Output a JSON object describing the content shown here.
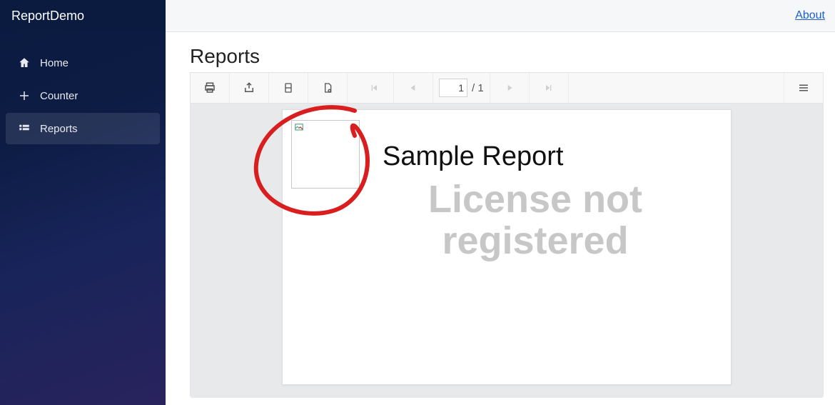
{
  "brand": "ReportDemo",
  "nav": {
    "items": [
      {
        "label": "Home"
      },
      {
        "label": "Counter"
      },
      {
        "label": "Reports"
      }
    ]
  },
  "topbar": {
    "about_label": "About"
  },
  "page": {
    "title": "Reports"
  },
  "toolbar": {
    "page_current": "1",
    "page_total": "/ 1"
  },
  "report": {
    "title": "Sample Report",
    "watermark": "License not\nregistered"
  }
}
